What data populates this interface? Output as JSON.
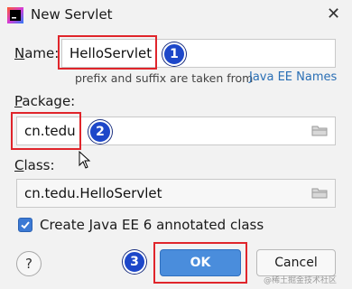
{
  "window": {
    "title": "New Servlet",
    "close_glyph": "✕"
  },
  "name_field": {
    "label_underlined": "N",
    "label_rest": "ame:",
    "value": "HelloServlet",
    "hint": "prefix and suffix are taken from",
    "hint_link": "Java EE Names"
  },
  "package_field": {
    "label_underlined": "P",
    "label_rest": "ackage:",
    "value": "cn.tedu"
  },
  "class_field": {
    "label_underlined": "C",
    "label_rest": "lass:",
    "value": "cn.tedu.HelloServlet"
  },
  "annotated_checkbox": {
    "checked": true,
    "label": "Create Java EE 6 annotated class"
  },
  "buttons": {
    "help": "?",
    "ok": "OK",
    "cancel": "Cancel"
  },
  "markers": [
    "1",
    "2",
    "3"
  ],
  "watermark": "@稀土掘金技术社区",
  "colors": {
    "highlight_box": "#e0252b",
    "marker_fill": "#1d47c9",
    "ok_button": "#4a8ddc",
    "link": "#2a6fb5",
    "checkbox": "#3b79d4"
  },
  "icons": [
    "intellij-app-icon",
    "close-icon",
    "folder-icon",
    "check-icon",
    "mouse-cursor-icon"
  ]
}
